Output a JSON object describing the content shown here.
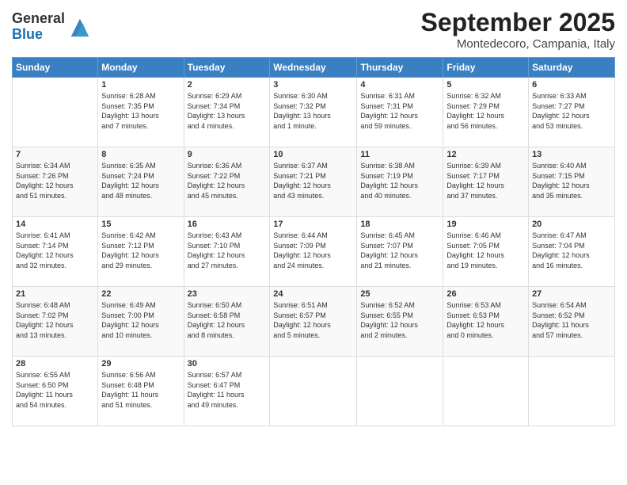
{
  "header": {
    "logo": {
      "general": "General",
      "blue": "Blue"
    },
    "title": "September 2025",
    "location": "Montedecoro, Campania, Italy"
  },
  "weekdays": [
    "Sunday",
    "Monday",
    "Tuesday",
    "Wednesday",
    "Thursday",
    "Friday",
    "Saturday"
  ],
  "weeks": [
    [
      {
        "day": "",
        "info": ""
      },
      {
        "day": "1",
        "info": "Sunrise: 6:28 AM\nSunset: 7:35 PM\nDaylight: 13 hours\nand 7 minutes."
      },
      {
        "day": "2",
        "info": "Sunrise: 6:29 AM\nSunset: 7:34 PM\nDaylight: 13 hours\nand 4 minutes."
      },
      {
        "day": "3",
        "info": "Sunrise: 6:30 AM\nSunset: 7:32 PM\nDaylight: 13 hours\nand 1 minute."
      },
      {
        "day": "4",
        "info": "Sunrise: 6:31 AM\nSunset: 7:31 PM\nDaylight: 12 hours\nand 59 minutes."
      },
      {
        "day": "5",
        "info": "Sunrise: 6:32 AM\nSunset: 7:29 PM\nDaylight: 12 hours\nand 56 minutes."
      },
      {
        "day": "6",
        "info": "Sunrise: 6:33 AM\nSunset: 7:27 PM\nDaylight: 12 hours\nand 53 minutes."
      }
    ],
    [
      {
        "day": "7",
        "info": "Sunrise: 6:34 AM\nSunset: 7:26 PM\nDaylight: 12 hours\nand 51 minutes."
      },
      {
        "day": "8",
        "info": "Sunrise: 6:35 AM\nSunset: 7:24 PM\nDaylight: 12 hours\nand 48 minutes."
      },
      {
        "day": "9",
        "info": "Sunrise: 6:36 AM\nSunset: 7:22 PM\nDaylight: 12 hours\nand 45 minutes."
      },
      {
        "day": "10",
        "info": "Sunrise: 6:37 AM\nSunset: 7:21 PM\nDaylight: 12 hours\nand 43 minutes."
      },
      {
        "day": "11",
        "info": "Sunrise: 6:38 AM\nSunset: 7:19 PM\nDaylight: 12 hours\nand 40 minutes."
      },
      {
        "day": "12",
        "info": "Sunrise: 6:39 AM\nSunset: 7:17 PM\nDaylight: 12 hours\nand 37 minutes."
      },
      {
        "day": "13",
        "info": "Sunrise: 6:40 AM\nSunset: 7:15 PM\nDaylight: 12 hours\nand 35 minutes."
      }
    ],
    [
      {
        "day": "14",
        "info": "Sunrise: 6:41 AM\nSunset: 7:14 PM\nDaylight: 12 hours\nand 32 minutes."
      },
      {
        "day": "15",
        "info": "Sunrise: 6:42 AM\nSunset: 7:12 PM\nDaylight: 12 hours\nand 29 minutes."
      },
      {
        "day": "16",
        "info": "Sunrise: 6:43 AM\nSunset: 7:10 PM\nDaylight: 12 hours\nand 27 minutes."
      },
      {
        "day": "17",
        "info": "Sunrise: 6:44 AM\nSunset: 7:09 PM\nDaylight: 12 hours\nand 24 minutes."
      },
      {
        "day": "18",
        "info": "Sunrise: 6:45 AM\nSunset: 7:07 PM\nDaylight: 12 hours\nand 21 minutes."
      },
      {
        "day": "19",
        "info": "Sunrise: 6:46 AM\nSunset: 7:05 PM\nDaylight: 12 hours\nand 19 minutes."
      },
      {
        "day": "20",
        "info": "Sunrise: 6:47 AM\nSunset: 7:04 PM\nDaylight: 12 hours\nand 16 minutes."
      }
    ],
    [
      {
        "day": "21",
        "info": "Sunrise: 6:48 AM\nSunset: 7:02 PM\nDaylight: 12 hours\nand 13 minutes."
      },
      {
        "day": "22",
        "info": "Sunrise: 6:49 AM\nSunset: 7:00 PM\nDaylight: 12 hours\nand 10 minutes."
      },
      {
        "day": "23",
        "info": "Sunrise: 6:50 AM\nSunset: 6:58 PM\nDaylight: 12 hours\nand 8 minutes."
      },
      {
        "day": "24",
        "info": "Sunrise: 6:51 AM\nSunset: 6:57 PM\nDaylight: 12 hours\nand 5 minutes."
      },
      {
        "day": "25",
        "info": "Sunrise: 6:52 AM\nSunset: 6:55 PM\nDaylight: 12 hours\nand 2 minutes."
      },
      {
        "day": "26",
        "info": "Sunrise: 6:53 AM\nSunset: 6:53 PM\nDaylight: 12 hours\nand 0 minutes."
      },
      {
        "day": "27",
        "info": "Sunrise: 6:54 AM\nSunset: 6:52 PM\nDaylight: 11 hours\nand 57 minutes."
      }
    ],
    [
      {
        "day": "28",
        "info": "Sunrise: 6:55 AM\nSunset: 6:50 PM\nDaylight: 11 hours\nand 54 minutes."
      },
      {
        "day": "29",
        "info": "Sunrise: 6:56 AM\nSunset: 6:48 PM\nDaylight: 11 hours\nand 51 minutes."
      },
      {
        "day": "30",
        "info": "Sunrise: 6:57 AM\nSunset: 6:47 PM\nDaylight: 11 hours\nand 49 minutes."
      },
      {
        "day": "",
        "info": ""
      },
      {
        "day": "",
        "info": ""
      },
      {
        "day": "",
        "info": ""
      },
      {
        "day": "",
        "info": ""
      }
    ]
  ]
}
